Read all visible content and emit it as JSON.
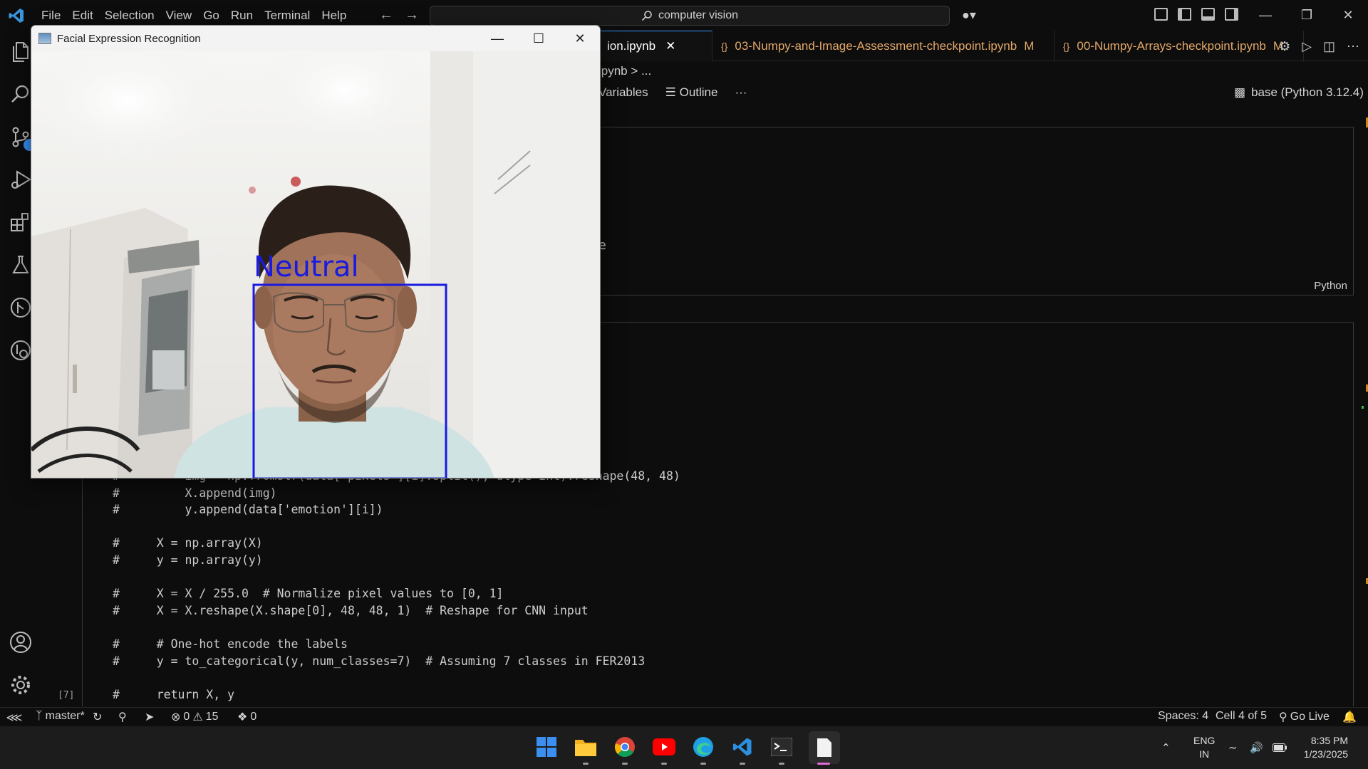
{
  "menu": [
    "File",
    "Edit",
    "Selection",
    "View",
    "Go",
    "Run",
    "Terminal",
    "Help"
  ],
  "command_center": {
    "text": "computer vision"
  },
  "tabs": [
    {
      "label": "ion.ipynb",
      "active": true
    },
    {
      "label": "03-Numpy-and-Image-Assessment-checkpoint.ipynb",
      "modified": "M"
    },
    {
      "label": "00-Numpy-Arrays-checkpoint.ipynb",
      "modified": "M"
    }
  ],
  "breadcrumb": "ipynb > ...",
  "notebook_toolbar": {
    "variables": "Variables",
    "outline": "Outline",
    "more": "···"
  },
  "kernel": "base (Python 3.12.4)",
  "cell1": {
    "language": "Python",
    "fragment": "e"
  },
  "cell2": {
    "exec_count": "[7]",
    "lines": [
      {
        "gutter": "#",
        "code": "        img = np.fromstr(data['pixels'][i].split(), dtype=int).reshape(48, 48)"
      },
      {
        "gutter": "#",
        "code": "        X.append(img)"
      },
      {
        "gutter": "#",
        "code": "        y.append(data['emotion'][i])"
      },
      {
        "gutter": "",
        "code": ""
      },
      {
        "gutter": "#",
        "code": "    X = np.array(X)"
      },
      {
        "gutter": "#",
        "code": "    y = np.array(y)"
      },
      {
        "gutter": "",
        "code": ""
      },
      {
        "gutter": "#",
        "code": "    X = X / 255.0  # Normalize pixel values to [0, 1]"
      },
      {
        "gutter": "#",
        "code": "    X = X.reshape(X.shape[0], 48, 48, 1)  # Reshape for CNN input"
      },
      {
        "gutter": "",
        "code": ""
      },
      {
        "gutter": "#",
        "code": "    # One-hot encode the labels"
      },
      {
        "gutter": "#",
        "code": "    y = to_categorical(y, num_classes=7)  # Assuming 7 classes in FER2013"
      },
      {
        "gutter": "",
        "code": ""
      },
      {
        "gutter": "#",
        "code": "    return X, y"
      }
    ]
  },
  "statusbar": {
    "branch": "master*",
    "errors": "0",
    "warnings": "15",
    "ports": "0",
    "spaces": "Spaces: 4",
    "cell": "Cell 4 of 5",
    "golive": "Go Live"
  },
  "floating_window": {
    "title": "Facial Expression Recognition",
    "emotion_label": "Neutral",
    "label_color": "#1a1ae0"
  },
  "tray": {
    "lang_top": "ENG",
    "lang_bottom": "IN",
    "time": "8:35 PM",
    "date": "1/23/2025"
  },
  "colors": {
    "accent": "#3794ff",
    "modified": "#e2a76a",
    "box": "#1a1ae0"
  }
}
